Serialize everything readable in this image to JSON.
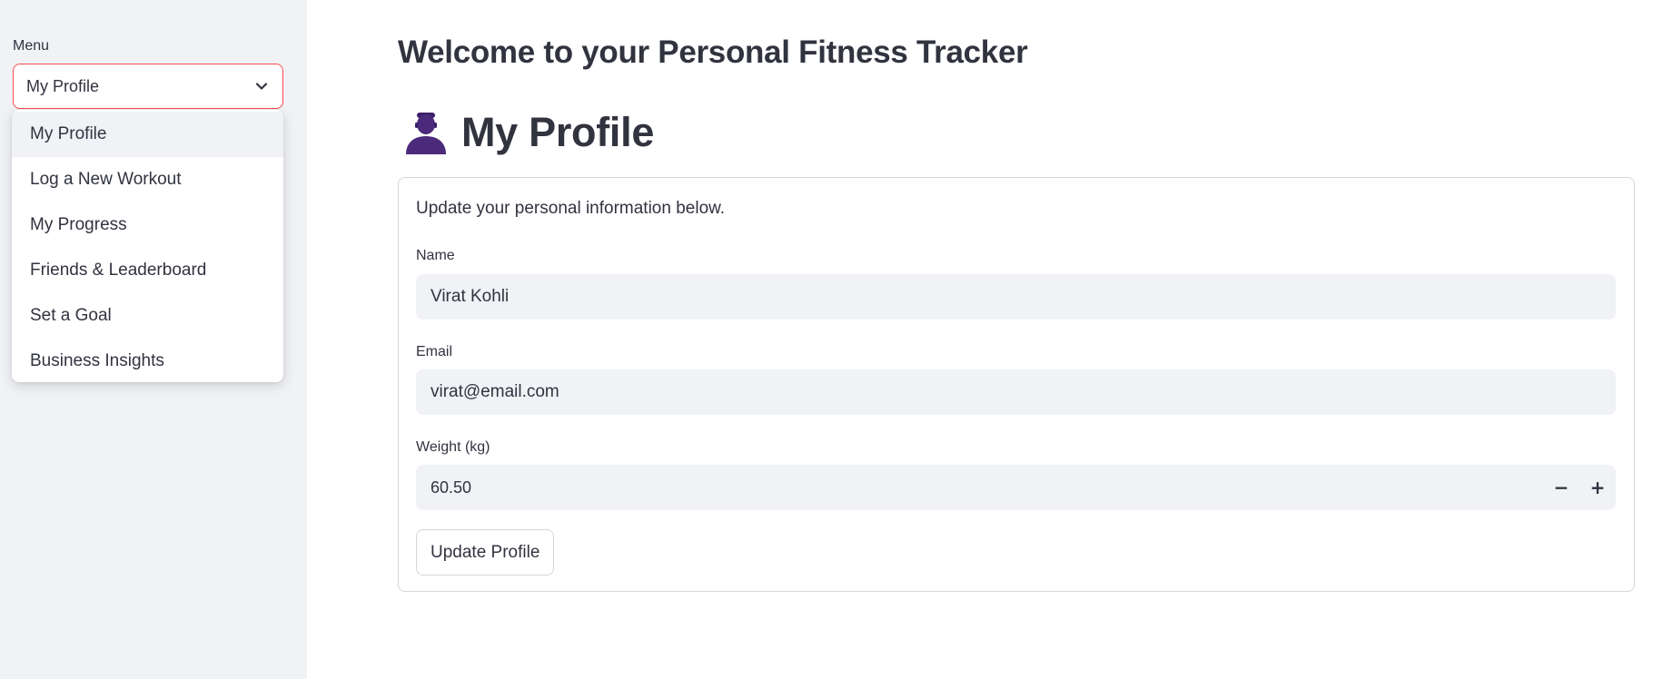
{
  "sidebar": {
    "menu_label": "Menu",
    "selected": "My Profile",
    "items": [
      {
        "label": "My Profile",
        "selected": true
      },
      {
        "label": "Log a New Workout",
        "selected": false
      },
      {
        "label": "My Progress",
        "selected": false
      },
      {
        "label": "Friends & Leaderboard",
        "selected": false
      },
      {
        "label": "Set a Goal",
        "selected": false
      },
      {
        "label": "Business Insights",
        "selected": false
      }
    ]
  },
  "main": {
    "title": "Welcome to your Personal Fitness Tracker",
    "section_title": "My Profile",
    "section_icon": "person-icon",
    "form": {
      "intro": "Update your personal information below.",
      "name_label": "Name",
      "name_value": "Virat Kohli",
      "email_label": "Email",
      "email_value": "virat@email.com",
      "weight_label": "Weight (kg)",
      "weight_value": "60.50",
      "minus": "−",
      "plus": "+",
      "submit_label": "Update Profile"
    }
  },
  "colors": {
    "accent": "#ff4b4b",
    "sidebar_bg": "#f0f2f6",
    "text": "#31333f",
    "input_bg": "#f0f2f6",
    "icon": "#4b2a7b"
  }
}
